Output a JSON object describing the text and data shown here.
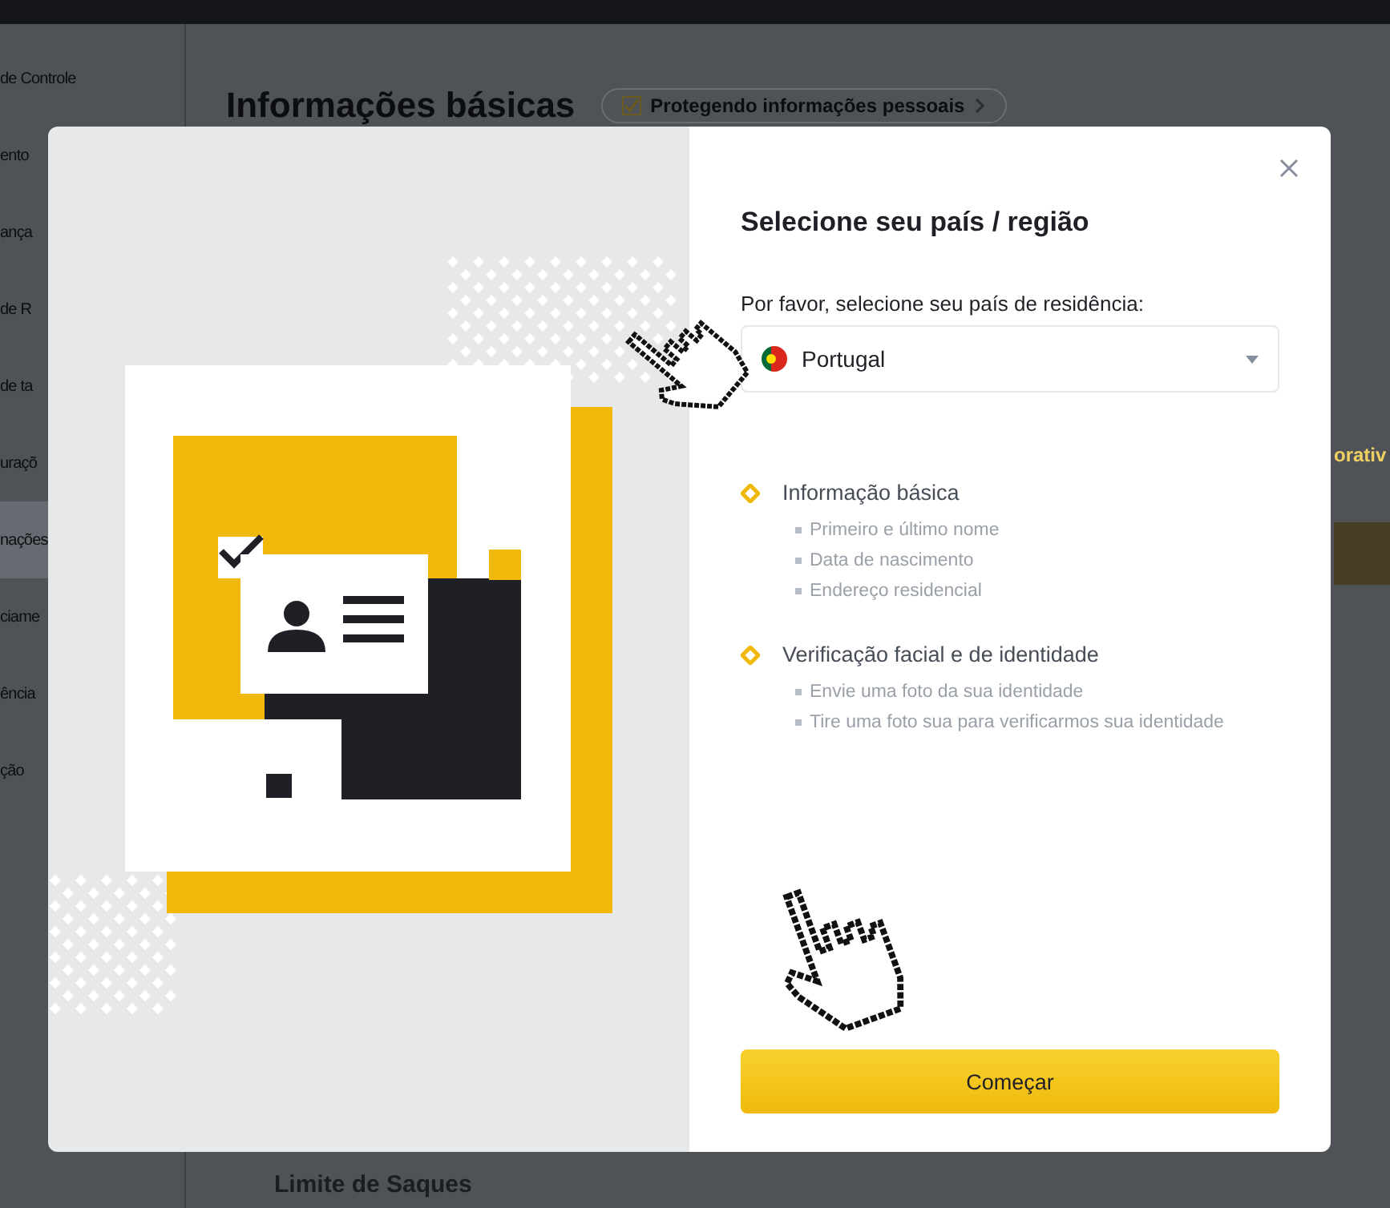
{
  "background": {
    "sidebar": {
      "items": [
        {
          "label": "de Controle",
          "selected": false
        },
        {
          "label": "ento",
          "selected": false
        },
        {
          "label": "ança",
          "selected": false
        },
        {
          "label": "de R",
          "selected": false
        },
        {
          "label": "de ta",
          "selected": false
        },
        {
          "label": "uraçõ",
          "selected": false
        },
        {
          "label": "nações",
          "selected": true
        },
        {
          "label": "ciame",
          "selected": false
        },
        {
          "label": "ência",
          "selected": false
        },
        {
          "label": "ção",
          "selected": false
        }
      ]
    },
    "heading": "Informações básicas",
    "badge": "Protegendo informações pessoais",
    "side_text": "orativ",
    "section_title": "Limite de Saques"
  },
  "dialog": {
    "title": "Selecione seu país / região",
    "field_label": "Por favor, selecione seu país de residência:",
    "country": {
      "value": "Portugal"
    },
    "steps": [
      {
        "title": "Informação básica",
        "items": [
          "Primeiro e último nome",
          "Data de nascimento",
          "Endereço residencial"
        ]
      },
      {
        "title": "Verificação facial e de identidade",
        "items": [
          "Envie uma foto da sua identidade",
          "Tire uma foto sua para verificarmos sua identidade"
        ]
      }
    ],
    "button": "Começar"
  }
}
